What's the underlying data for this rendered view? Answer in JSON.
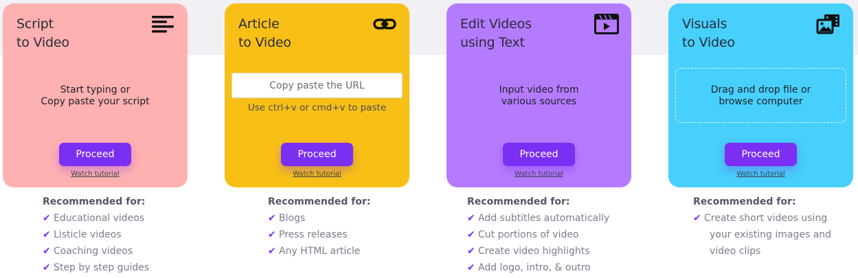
{
  "colors": {
    "card1": "#ffb1b1",
    "card2": "#f8c016",
    "card3": "#b57bff",
    "card4": "#46d0fb",
    "accent": "#7b2ff2",
    "band": "#f0f0f5"
  },
  "cards": [
    {
      "title_line1": "Script",
      "title_line2": "to Video",
      "icon": "text-lines-icon",
      "body_line1": "Start typing or",
      "body_line2": "Copy paste your script",
      "proceed_label": "Proceed",
      "tutorial_label": "Watch tutorial"
    },
    {
      "title_line1": "Article",
      "title_line2": "to Video",
      "icon": "link-icon",
      "url_placeholder": "Copy paste the URL",
      "paste_hint": "Use ctrl+v or cmd+v to paste",
      "proceed_label": "Proceed",
      "tutorial_label": "Watch tutorial"
    },
    {
      "title_line1": "Edit Videos",
      "title_line2": "using Text",
      "icon": "video-clapper-icon",
      "body_line1": "Input video from",
      "body_line2": "various sources",
      "proceed_label": "Proceed",
      "tutorial_label": "Watch tutorial"
    },
    {
      "title_line1": "Visuals",
      "title_line2": "to Video",
      "icon": "images-icon",
      "body_line1": "Drag and drop file or",
      "body_line2": "browse computer",
      "proceed_label": "Proceed",
      "tutorial_label": "Watch tutorial"
    }
  ],
  "recommendations": [
    {
      "heading": "Recommended for:",
      "items": [
        "Educational videos",
        "Listicle videos",
        "Coaching videos",
        "Step by step guides"
      ]
    },
    {
      "heading": "Recommended for:",
      "items": [
        "Blogs",
        "Press releases",
        "Any HTML article"
      ]
    },
    {
      "heading": "Recommended for:",
      "items": [
        "Add subtitles automatically",
        "Cut portions of video",
        "Create video highlights",
        "Add logo, intro, & outro"
      ]
    },
    {
      "heading": "Recommended for:",
      "items": [
        "Create short videos using"
      ],
      "continuation": [
        "your existing images and",
        "video clips"
      ]
    }
  ]
}
